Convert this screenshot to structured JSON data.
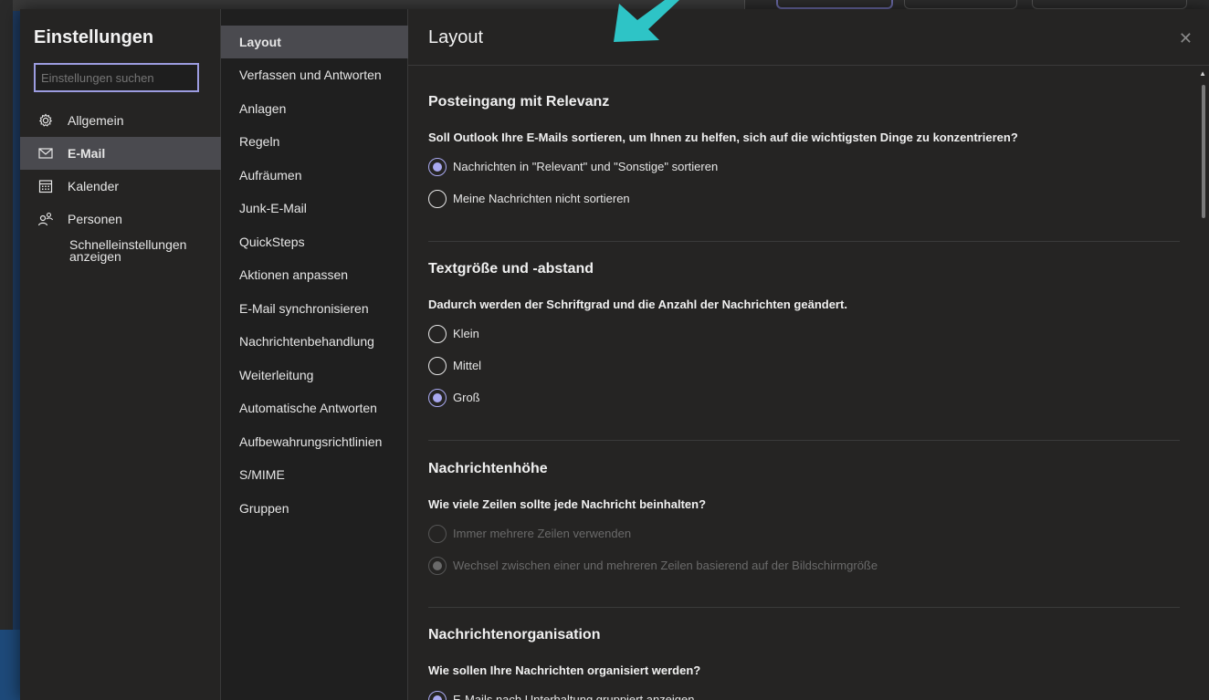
{
  "settings": {
    "title": "Einstellungen",
    "search_placeholder": "Einstellungen suchen",
    "categories": [
      {
        "label": "Allgemein",
        "icon": "gear-icon"
      },
      {
        "label": "E-Mail",
        "icon": "mail-icon",
        "active": true
      },
      {
        "label": "Kalender",
        "icon": "calendar-icon"
      },
      {
        "label": "Personen",
        "icon": "people-icon"
      }
    ],
    "quick_settings_label": "Schnelleinstellungen anzeigen"
  },
  "mail_nav": {
    "items": [
      "Layout",
      "Verfassen und Antworten",
      "Anlagen",
      "Regeln",
      "Aufräumen",
      "Junk-E-Mail",
      "QuickSteps",
      "Aktionen anpassen",
      "E-Mail synchronisieren",
      "Nachrichtenbehandlung",
      "Weiterleitung",
      "Automatische Antworten",
      "Aufbewahrungsrichtlinien",
      "S/MIME",
      "Gruppen"
    ],
    "active_index": 0
  },
  "content": {
    "page_title": "Layout",
    "close_label": "✕",
    "sections": [
      {
        "title": "Posteingang mit Relevanz",
        "question": "Soll Outlook Ihre E-Mails sortieren, um Ihnen zu helfen, sich auf die wichtigsten Dinge zu konzentrieren?",
        "options": [
          {
            "label": "Nachrichten in \"Relevant\" und \"Sonstige\" sortieren",
            "checked": true
          },
          {
            "label": "Meine Nachrichten nicht sortieren",
            "checked": false
          }
        ]
      },
      {
        "title": "Textgröße und -abstand",
        "question": "Dadurch werden der Schriftgrad und die Anzahl der Nachrichten geändert.",
        "options": [
          {
            "label": "Klein",
            "checked": false
          },
          {
            "label": "Mittel",
            "checked": false
          },
          {
            "label": "Groß",
            "checked": true
          }
        ]
      },
      {
        "title": "Nachrichtenhöhe",
        "question": "Wie viele Zeilen sollte jede Nachricht beinhalten?",
        "options": [
          {
            "label": "Immer mehrere Zeilen verwenden",
            "checked": false,
            "disabled": true
          },
          {
            "label": "Wechsel zwischen einer und mehreren Zeilen basierend auf der Bildschirmgröße",
            "checked": true,
            "disabled": true
          }
        ]
      },
      {
        "title": "Nachrichtenorganisation",
        "question": "Wie sollen Ihre Nachrichten organisiert werden?",
        "options": [
          {
            "label": "E-Mails nach Unterhaltung gruppiert anzeigen",
            "checked": true
          }
        ]
      }
    ]
  },
  "colors": {
    "accent": "#a9a9f0",
    "annotation_arrow": "#2ec4c6",
    "panel_bg": "#252423",
    "selected_bg": "#4a4a4f"
  }
}
